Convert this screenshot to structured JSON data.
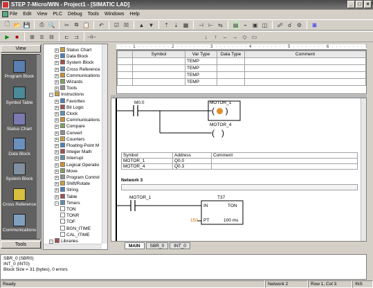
{
  "window": {
    "title": "STEP 7-Micro/WIN - Project1 - [SIMATIC LAD]",
    "controls": [
      "_",
      "□",
      "×"
    ]
  },
  "menu": [
    "File",
    "Edit",
    "View",
    "PLC",
    "Debug",
    "Tools",
    "Windows",
    "Help"
  ],
  "toolbar_row1": [
    "new-icon",
    "open-icon",
    "save-icon",
    "print-icon",
    "preview-icon",
    "cut-icon",
    "copy-icon",
    "paste-icon",
    "undo-icon",
    "compile-icon",
    "compile-all-icon",
    "upload-icon",
    "download-icon",
    "sort-asc-icon",
    "sort-desc-icon",
    "options-icon",
    "network-insert-icon",
    "network-delete-icon",
    "symbol-icon",
    "status-icon",
    "trend-icon",
    "force-icon",
    "unforce-icon",
    "read-icon",
    "write-icon",
    "program-status-icon",
    "sym-icon"
  ],
  "toolbar_row2": [
    "run-icon",
    "stop-icon",
    "lad-icon",
    "stl-icon",
    "fbd-icon",
    "rung-icon",
    "network-icon",
    "contact-icon",
    "arrow-left-icon",
    "arrow-right-icon",
    "line-down-icon",
    "line-up-icon",
    "coil-icon",
    "box-icon"
  ],
  "nav": {
    "header": "View",
    "footer": "Tools",
    "items": [
      {
        "label": "Program Block",
        "color": "#5a7fb0"
      },
      {
        "label": "Symbol Table",
        "color": "#4a8a9a"
      },
      {
        "label": "Status Chart",
        "color": "#7a7ab0"
      },
      {
        "label": "Data Block",
        "color": "#6a90c0"
      },
      {
        "label": "System Block",
        "color": "#8090a0"
      },
      {
        "label": "Cross Reference",
        "color": "#d8c040"
      },
      {
        "label": "Communications",
        "color": "#80a0c0"
      }
    ]
  },
  "tree": {
    "items": [
      {
        "label": "Status Chart",
        "indent": 2
      },
      {
        "label": "Data Block",
        "indent": 2
      },
      {
        "label": "System Block",
        "indent": 2
      },
      {
        "label": "Cross Reference",
        "indent": 2
      },
      {
        "label": "Communications",
        "indent": 2
      },
      {
        "label": "Wizards",
        "indent": 2
      },
      {
        "label": "Tools",
        "indent": 2
      },
      {
        "label": "Instructions",
        "indent": 1
      },
      {
        "label": "Favorites",
        "indent": 2
      },
      {
        "label": "Bit Logic",
        "indent": 2
      },
      {
        "label": "Clock",
        "indent": 2
      },
      {
        "label": "Communications",
        "indent": 2
      },
      {
        "label": "Compare",
        "indent": 2
      },
      {
        "label": "Convert",
        "indent": 2
      },
      {
        "label": "Counters",
        "indent": 2
      },
      {
        "label": "Floating-Point M",
        "indent": 2
      },
      {
        "label": "Integer Math",
        "indent": 2
      },
      {
        "label": "Interrupt",
        "indent": 2
      },
      {
        "label": "Logical Operatio",
        "indent": 2
      },
      {
        "label": "Move",
        "indent": 2
      },
      {
        "label": "Program Control",
        "indent": 2
      },
      {
        "label": "Shift/Rotate",
        "indent": 2
      },
      {
        "label": "String",
        "indent": 2
      },
      {
        "label": "Table",
        "indent": 2
      },
      {
        "label": "Timers",
        "indent": 2
      },
      {
        "label": "TON",
        "indent": 3
      },
      {
        "label": "TONR",
        "indent": 3
      },
      {
        "label": "TOF",
        "indent": 3
      },
      {
        "label": "BGN_ITIME",
        "indent": 3
      },
      {
        "label": "CAL_ITIME",
        "indent": 3
      },
      {
        "label": "Libraries",
        "indent": 1
      }
    ]
  },
  "ruler": "· · · · 1 · · · · · · · · 2 · · · · · · · · 3 · · · · · · · · 4 · · · · · · · · 5 · · · · · · · · 6 · · · · · · · · 7 · · · · · · · · 8",
  "var_table": {
    "headers": [
      "",
      "Symbol",
      "Var Type",
      "Data Type",
      "Comment"
    ],
    "rows": [
      [
        "",
        "",
        "TEMP",
        "",
        ""
      ],
      [
        "",
        "",
        "TEMP",
        "",
        ""
      ],
      [
        "",
        "",
        "TEMP",
        "",
        ""
      ],
      [
        "",
        "",
        "TEMP",
        "",
        ""
      ]
    ]
  },
  "ladder": {
    "contact1": "M0.0",
    "coil1": "MOTOR_1",
    "coil2": "MOTOR_4",
    "symbols": {
      "headers": [
        "Symbol",
        "Address",
        "Comment"
      ],
      "rows": [
        [
          "MOTOR_1",
          "Q0.0",
          ""
        ],
        [
          "MOTOR_4",
          "Q0.3",
          ""
        ]
      ]
    },
    "network3": "Network 3",
    "contact2": "MOTOR_1",
    "timer_name": "T37",
    "timer_in": "IN",
    "timer_type": "TON",
    "timer_preset_value": "150",
    "timer_pt": "PT",
    "timer_res": "100 ms"
  },
  "tabs": [
    "MAIN",
    "SBR_0",
    "INT_0"
  ],
  "output_lines": [
    "SBR_0 (SBR0)",
    "INT_0 (INT0)",
    "Block Size = 31 (bytes), 0 errors"
  ],
  "status": {
    "ready": "Ready",
    "network": "Network 2",
    "rowcol": "Row 1, Col 3",
    "mode": "INS"
  }
}
